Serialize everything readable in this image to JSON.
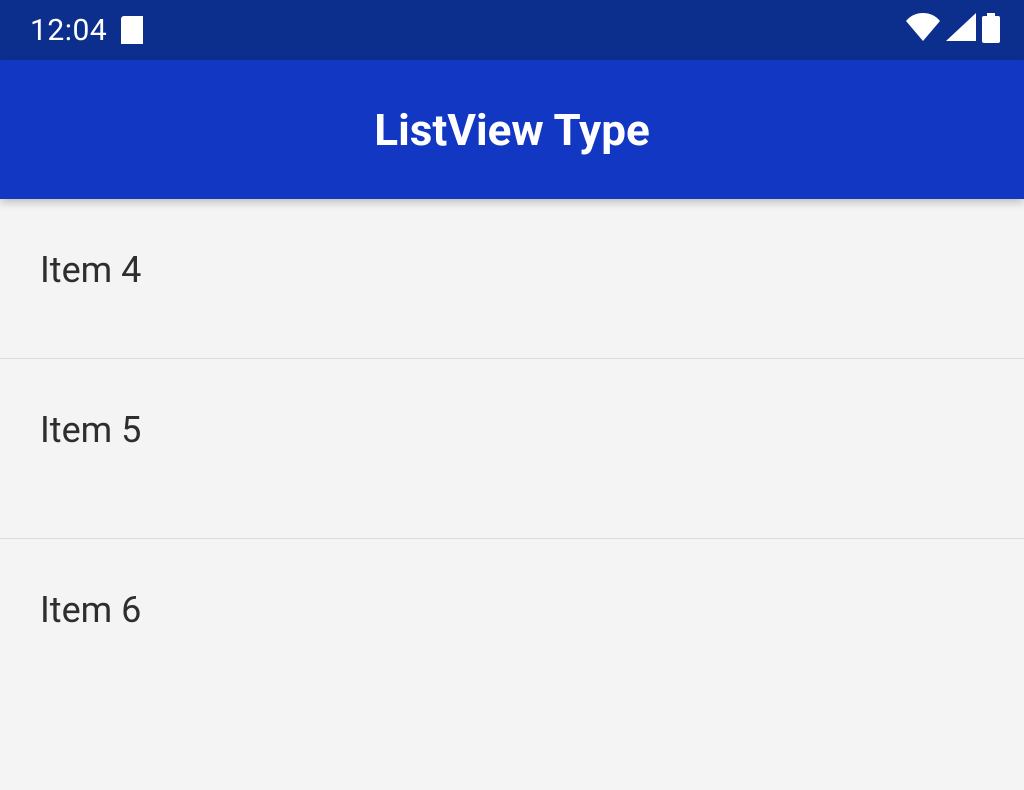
{
  "status": {
    "time": "12:04"
  },
  "app": {
    "title": "ListView Type"
  },
  "list": {
    "items": [
      {
        "label": "Item 4"
      },
      {
        "label": "Item 5"
      },
      {
        "label": "Item 6"
      }
    ]
  }
}
